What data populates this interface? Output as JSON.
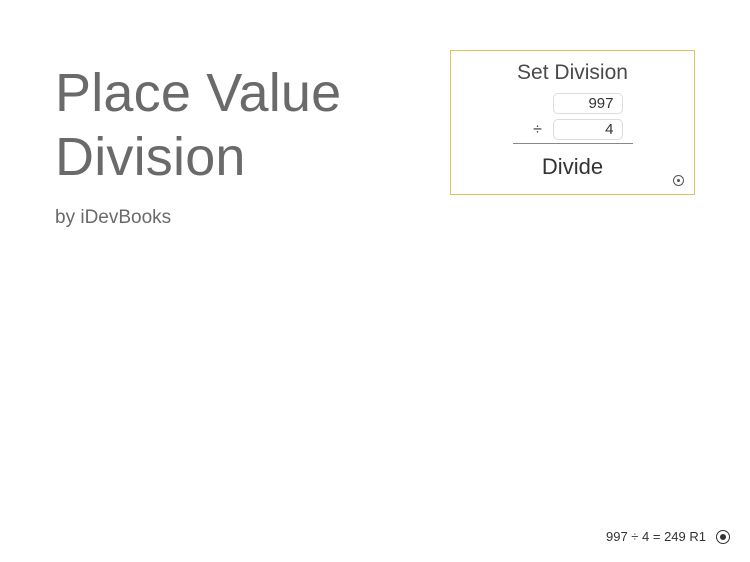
{
  "title": {
    "line1": "Place Value",
    "line2": "Division"
  },
  "subtitle": "by iDevBooks",
  "panel": {
    "title": "Set Division",
    "dividend": "997",
    "divisor": "4",
    "operator": "÷",
    "button_label": "Divide"
  },
  "footer": {
    "result": "997 ÷ 4 = 249 R1"
  }
}
